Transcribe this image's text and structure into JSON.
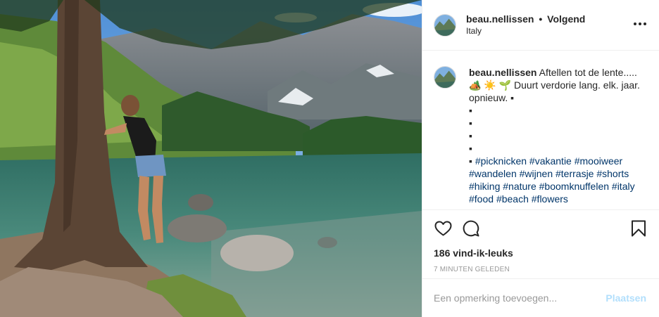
{
  "post": {
    "username": "beau.nellissen",
    "separator": "•",
    "follow_label": "Volgend",
    "location": "Italy",
    "photo_icon": "landscape-photo",
    "avatar_icon": "mountain-avatar"
  },
  "caption": {
    "username": "beau.nellissen",
    "line1": "Aftellen tot de lente.....",
    "line2": "🏕️ ☀️ 🌱 Duurt verdorie lang. elk. jaar.",
    "line3": "opnieuw. ▪",
    "bullet1": "▪",
    "bullet2": "▪",
    "bullet3": "▪",
    "bullet4": "▪",
    "hashtag_prefix": "▪ ",
    "hashtags": [
      "#picknicken",
      "#vakantie",
      "#mooiweer",
      "#wandelen",
      "#wijnen",
      "#terrasje",
      "#shorts",
      "#hiking",
      "#nature",
      "#boomknuffelen",
      "#italy",
      "#food",
      "#beach",
      "#flowers"
    ]
  },
  "actions": {
    "like_icon": "heart-icon",
    "comment_icon": "comment-icon",
    "save_icon": "bookmark-icon",
    "likes": "186 vind-ik-leuks",
    "time": "7 MINUTEN GELEDEN"
  },
  "comment": {
    "placeholder": "Een opmerking toevoegen...",
    "post_label": "Plaatsen"
  },
  "colors": {
    "text": "#262626",
    "hashtag": "#003569",
    "muted": "#999999",
    "post_button": "#b2dffc",
    "border": "#efefef"
  }
}
